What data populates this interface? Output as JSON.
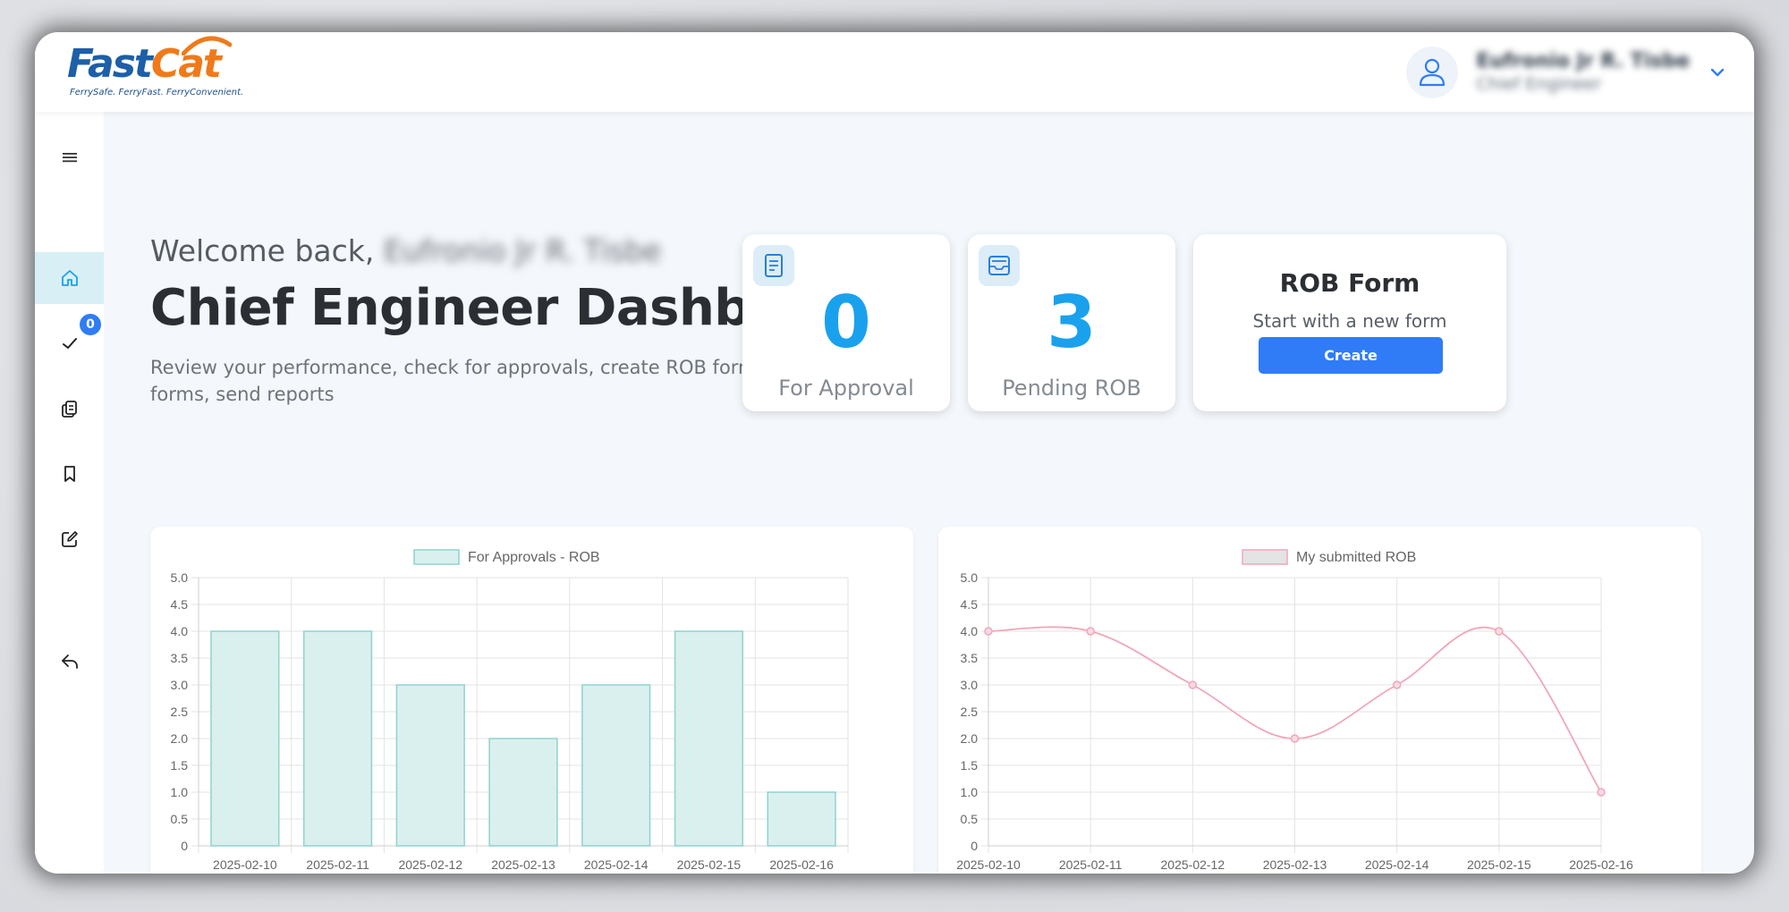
{
  "app": {
    "logo_fast": "Fast",
    "logo_cat": "Cat",
    "tagline": "FerrySafe. FerryFast. FerryConvenient.",
    "user_name": "Eufronio Jr R. Tisbe",
    "user_role": "Chief Engineer"
  },
  "sidebar": {
    "items": [
      {
        "icon": "menu-icon"
      },
      {
        "icon": "home-icon"
      },
      {
        "icon": "check-icon",
        "badge": "0"
      },
      {
        "icon": "copy-document-icon"
      },
      {
        "icon": "bookmark-icon"
      },
      {
        "icon": "edit-icon"
      },
      {
        "icon": "logout-icon"
      }
    ]
  },
  "header": {
    "welcome": "Welcome back,",
    "welcome_name": "Eufronio Jr R. Tisbe",
    "title": "Chief Engineer Dashboard",
    "subtitle": "Review your performance, check for approvals, create ROB form, view ROB forms, send reports"
  },
  "stats": {
    "approval": {
      "value": "0",
      "label": "For Approval"
    },
    "pending": {
      "value": "3",
      "label": "Pending ROB"
    }
  },
  "rob_form": {
    "title": "ROB Form",
    "subtitle": "Start with a new form",
    "button": "Create"
  },
  "colors": {
    "accent": "#2f7cf6",
    "number": "#1aa1ee",
    "bar_fill": "#d9f0ef",
    "bar_stroke": "#8fd3cf",
    "line_stroke": "#f2a6b8"
  },
  "chart_data": [
    {
      "type": "bar",
      "categories": [
        "2025-02-10",
        "2025-02-11",
        "2025-02-12",
        "2025-02-13",
        "2025-02-14",
        "2025-02-15",
        "2025-02-16"
      ],
      "series": [
        {
          "name": "For Approvals - ROB",
          "values": [
            4,
            4,
            3,
            2,
            3,
            4,
            1
          ]
        }
      ],
      "ylim": [
        0,
        5
      ],
      "yticks": [
        "5.0",
        "4.5",
        "4.0",
        "3.5",
        "3.0",
        "2.5",
        "2.0",
        "1.5",
        "1.0",
        "0.5",
        "0"
      ],
      "legend": "top",
      "grid": true
    },
    {
      "type": "line",
      "categories": [
        "2025-02-10",
        "2025-02-11",
        "2025-02-12",
        "2025-02-13",
        "2025-02-14",
        "2025-02-15",
        "2025-02-16"
      ],
      "series": [
        {
          "name": "My submitted ROB",
          "values": [
            4,
            4,
            3,
            2,
            3,
            4,
            1
          ]
        }
      ],
      "ylim": [
        0,
        5
      ],
      "yticks": [
        "5.0",
        "4.5",
        "4.0",
        "3.5",
        "3.0",
        "2.5",
        "2.0",
        "1.5",
        "1.0",
        "0.5",
        "0"
      ],
      "legend": "top",
      "grid": true
    }
  ]
}
